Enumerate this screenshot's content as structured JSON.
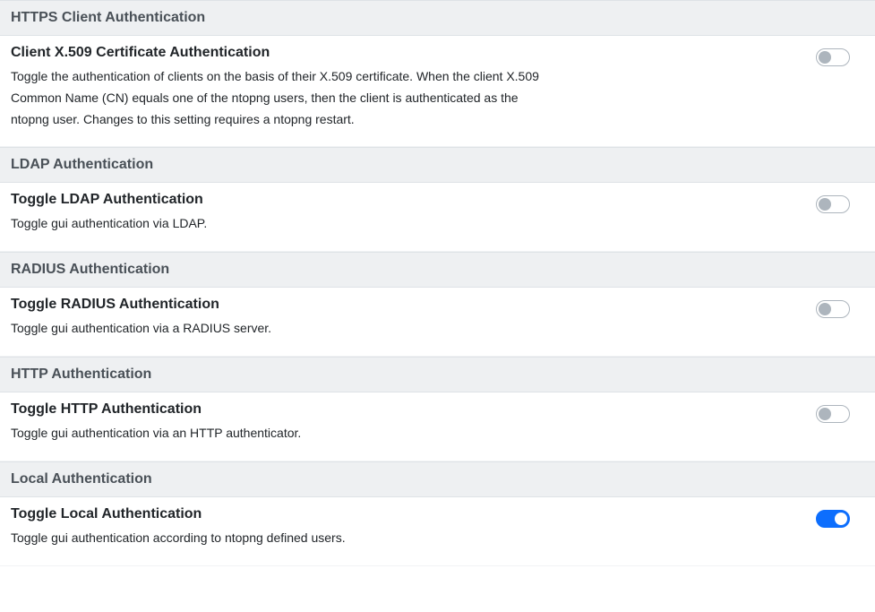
{
  "sections": [
    {
      "header": "HTTPS Client Authentication",
      "title": "Client X.509 Certificate Authentication",
      "desc": "Toggle the authentication of clients on the basis of their X.509 certificate. When the client X.509 Common Name (CN) equals one of the ntopng users, then the client is authenticated as the ntopng user. Changes to this setting requires a ntopng restart.",
      "enabled": false
    },
    {
      "header": "LDAP Authentication",
      "title": "Toggle LDAP Authentication",
      "desc": "Toggle gui authentication via LDAP.",
      "enabled": false
    },
    {
      "header": "RADIUS Authentication",
      "title": "Toggle RADIUS Authentication",
      "desc": "Toggle gui authentication via a RADIUS server.",
      "enabled": false
    },
    {
      "header": "HTTP Authentication",
      "title": "Toggle HTTP Authentication",
      "desc": "Toggle gui authentication via an HTTP authenticator.",
      "enabled": false
    },
    {
      "header": "Local Authentication",
      "title": "Toggle Local Authentication",
      "desc": "Toggle gui authentication according to ntopng defined users.",
      "enabled": true
    }
  ]
}
